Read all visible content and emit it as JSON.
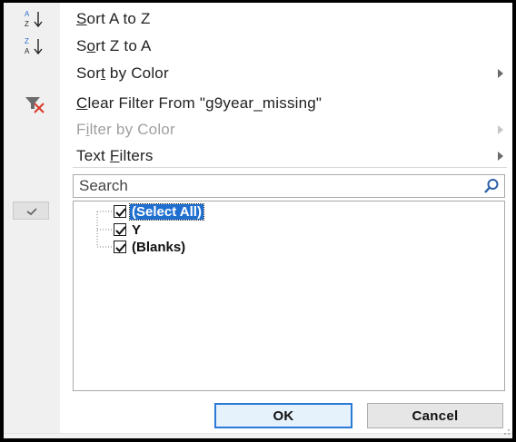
{
  "menu": {
    "sort_az": {
      "prefix": "",
      "accel": "S",
      "suffix": "ort A to Z",
      "icon": "sort-ascending-icon"
    },
    "sort_za": {
      "prefix": "S",
      "accel": "o",
      "suffix": "rt Z to A",
      "icon": "sort-descending-icon"
    },
    "sort_by_color": {
      "prefix": "Sor",
      "accel": "t",
      "suffix": " by Color"
    },
    "clear_filter": {
      "prefix": "",
      "accel": "C",
      "suffix": "lear Filter From \"g9year_missing\"",
      "icon": "clear-filter-icon"
    },
    "filter_by_color": {
      "prefix": "F",
      "accel": "i",
      "suffix": "lter by Color"
    },
    "text_filters": {
      "prefix": "Text ",
      "accel": "F",
      "suffix": "ilters"
    }
  },
  "search": {
    "placeholder": "Search"
  },
  "values_list": {
    "items": [
      {
        "label": "(Select All)",
        "checked": true,
        "selected": true
      },
      {
        "label": "Y",
        "checked": true,
        "selected": false
      },
      {
        "label": "(Blanks)",
        "checked": true,
        "selected": false
      }
    ]
  },
  "buttons": {
    "ok": "OK",
    "cancel": "Cancel"
  },
  "colors": {
    "selection": "#1f6fd0",
    "ok_border": "#2a7ad6",
    "clear_filter_x": "#d93a2b"
  }
}
